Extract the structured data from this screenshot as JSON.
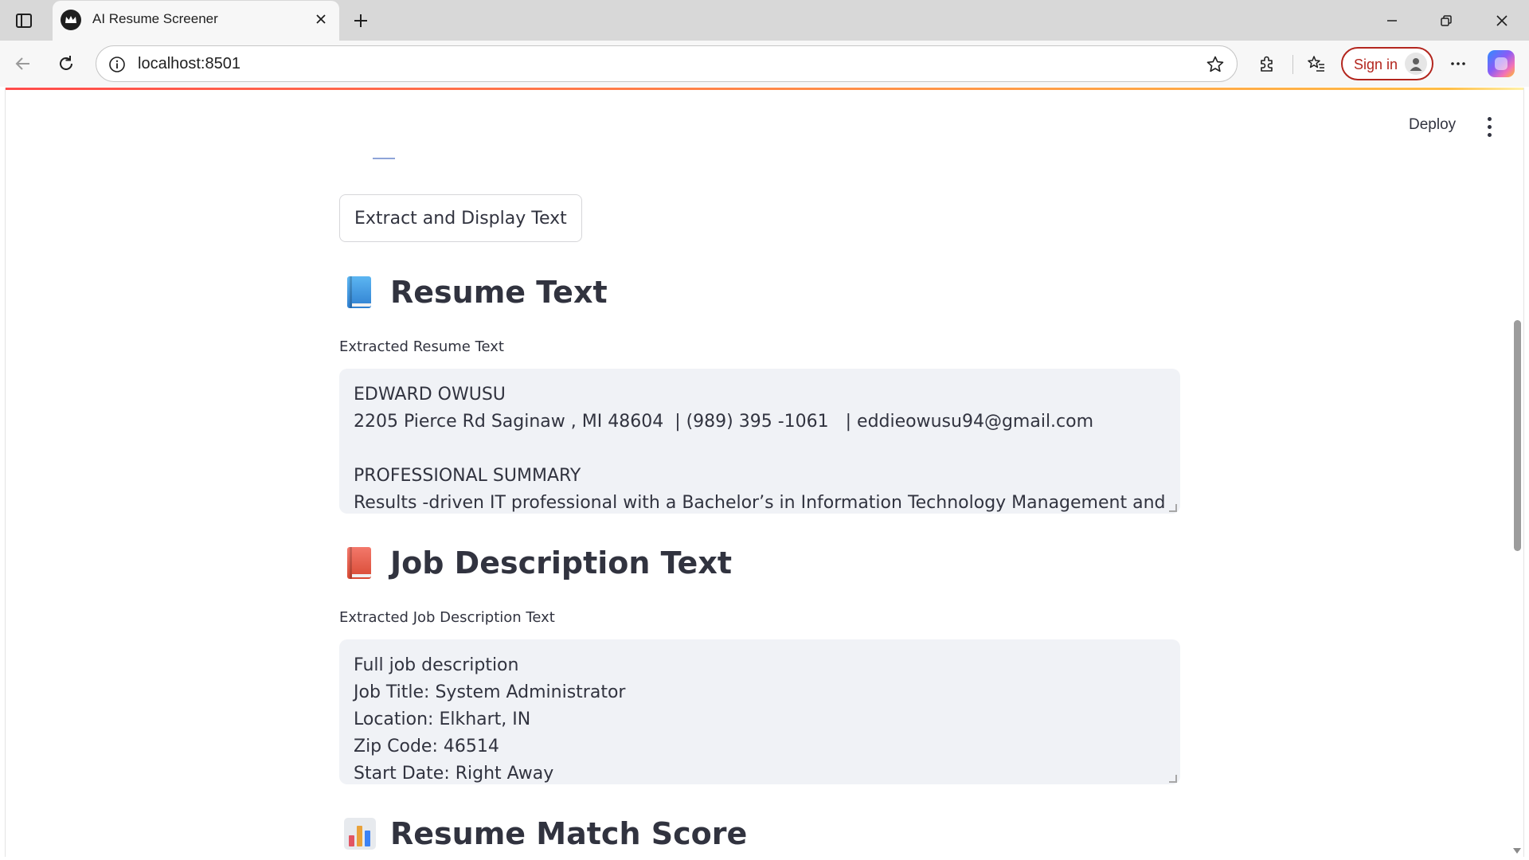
{
  "browser": {
    "tab_title": "AI Resume Screener",
    "url": "localhost:8501",
    "sign_in_label": "Sign in"
  },
  "app": {
    "toolbar": {
      "deploy_label": "Deploy"
    },
    "extract_button_label": "Extract and Display Text",
    "resume_section": {
      "heading": "Resume Text",
      "icon": "blue-book-icon",
      "field_label": "Extracted Resume Text",
      "lines": [
        "EDWARD OWUSU",
        "2205 Pierce Rd Saginaw , MI 48604  | (989) 395 -1061   | eddieowusu94@gmail.com",
        "",
        "PROFESSIONAL SUMMARY",
        "Results -driven IT professional with a Bachelor’s in Information Technology Management and"
      ]
    },
    "job_section": {
      "heading": "Job Description Text",
      "icon": "red-book-icon",
      "field_label": "Extracted Job Description Text",
      "lines": [
        "Full job description",
        "Job Title: System Administrator",
        "Location: Elkhart, IN",
        "Zip Code: 46514",
        "Start Date: Right Away"
      ]
    },
    "score_section": {
      "heading": "Resume Match Score",
      "icon": "bar-chart-icon"
    }
  },
  "colors": {
    "accent_red": "#ff4b4b",
    "text": "#31333f",
    "field_bg": "#f0f2f6",
    "signin_red": "#b3261e"
  }
}
